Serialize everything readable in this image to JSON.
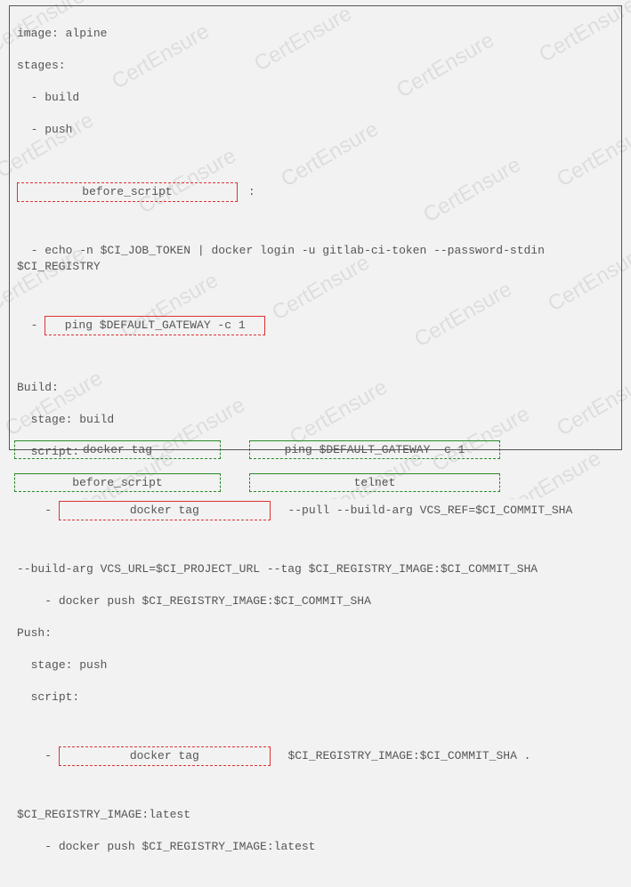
{
  "code": {
    "l1": "image: alpine",
    "l2": "stages:",
    "l3": "  - build",
    "l4": "  - push",
    "blank1": "before_script",
    "blank1_suffix": " :",
    "l6": "  - echo -n $CI_JOB_TOKEN | docker login -u gitlab-ci-token --password-stdin $CI_REGISTRY",
    "prefix_blank2": "  - ",
    "blank2": "ping $DEFAULT_GATEWAY -c 1",
    "l8": "Build:",
    "l9": "  stage: build",
    "l10": "  script:",
    "prefix_blank3": "    - ",
    "blank3": "docker tag",
    "blank3_suffix": "  --pull --build-arg VCS_REF=$CI_COMMIT_SHA",
    "l12": "--build-arg VCS_URL=$CI_PROJECT_URL --tag $CI_REGISTRY_IMAGE:$CI_COMMIT_SHA",
    "l13": "    - docker push $CI_REGISTRY_IMAGE:$CI_COMMIT_SHA",
    "l14": "Push:",
    "l15": "  stage: push",
    "l16": "  script:",
    "prefix_blank4": "    - ",
    "blank4": "docker tag",
    "blank4_suffix": "  $CI_REGISTRY_IMAGE:$CI_COMMIT_SHA .",
    "l18": "$CI_REGISTRY_IMAGE:latest",
    "l19": "    - docker push $CI_REGISTRY_IMAGE:latest"
  },
  "answers": {
    "a1": "docker tag",
    "a2": "ping $DEFAULT_GATEWAY -c 1",
    "a3": "before_script",
    "a4": "telnet"
  },
  "watermark": "CertEnsure"
}
